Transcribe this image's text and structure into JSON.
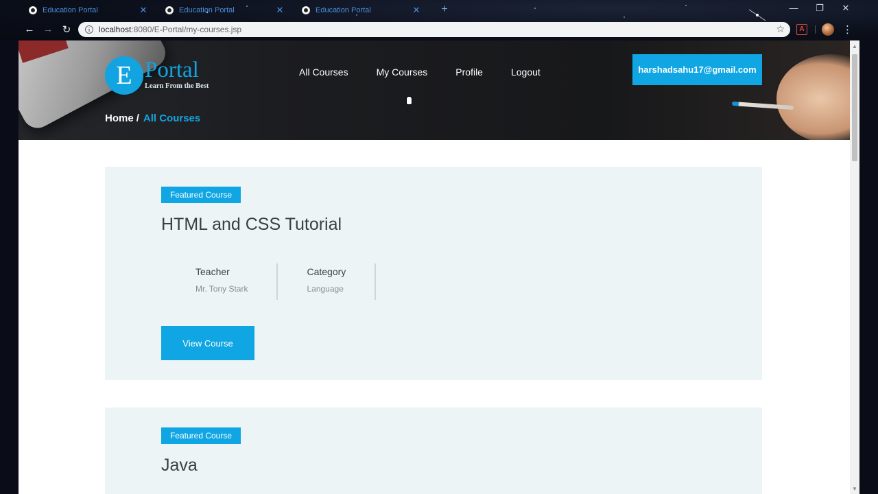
{
  "browser": {
    "tabs": [
      {
        "title": "Education Portal",
        "close": "✕"
      },
      {
        "title": "Education Portal",
        "close": "✕"
      },
      {
        "title": "Education Portal",
        "close": "✕"
      }
    ],
    "new_tab": "+",
    "window_controls": {
      "minimize": "—",
      "restore": "❐",
      "close": "✕"
    },
    "nav": {
      "back": "←",
      "forward": "→",
      "reload": "↻"
    },
    "url": {
      "host": "localhost",
      "path": ":8080/E-Portal/my-courses.jsp"
    },
    "icons": {
      "info": "i",
      "star": "☆",
      "pdf": "A",
      "menu": "⋮"
    }
  },
  "site": {
    "logo": {
      "letter": "E",
      "name": "Portal",
      "tagline": "Learn From the Best"
    },
    "nav": [
      {
        "label": "All Courses"
      },
      {
        "label": "My Courses"
      },
      {
        "label": "Profile"
      },
      {
        "label": "Logout"
      }
    ],
    "user_email": "harshadsahu17@gmail.com",
    "breadcrumb": {
      "home": "Home",
      "separator": "/",
      "current": "All Courses"
    }
  },
  "courses": [
    {
      "badge": "Featured Course",
      "title": "HTML and CSS Tutorial",
      "teacher_label": "Teacher",
      "teacher": "Mr. Tony Stark",
      "category_label": "Category",
      "category": "Language",
      "button": "View Course"
    },
    {
      "badge": "Featured Course",
      "title": "Java"
    }
  ],
  "colors": {
    "accent": "#0fa6e3",
    "card_bg": "#ecf4f5",
    "title_text": "#3a3f45"
  }
}
